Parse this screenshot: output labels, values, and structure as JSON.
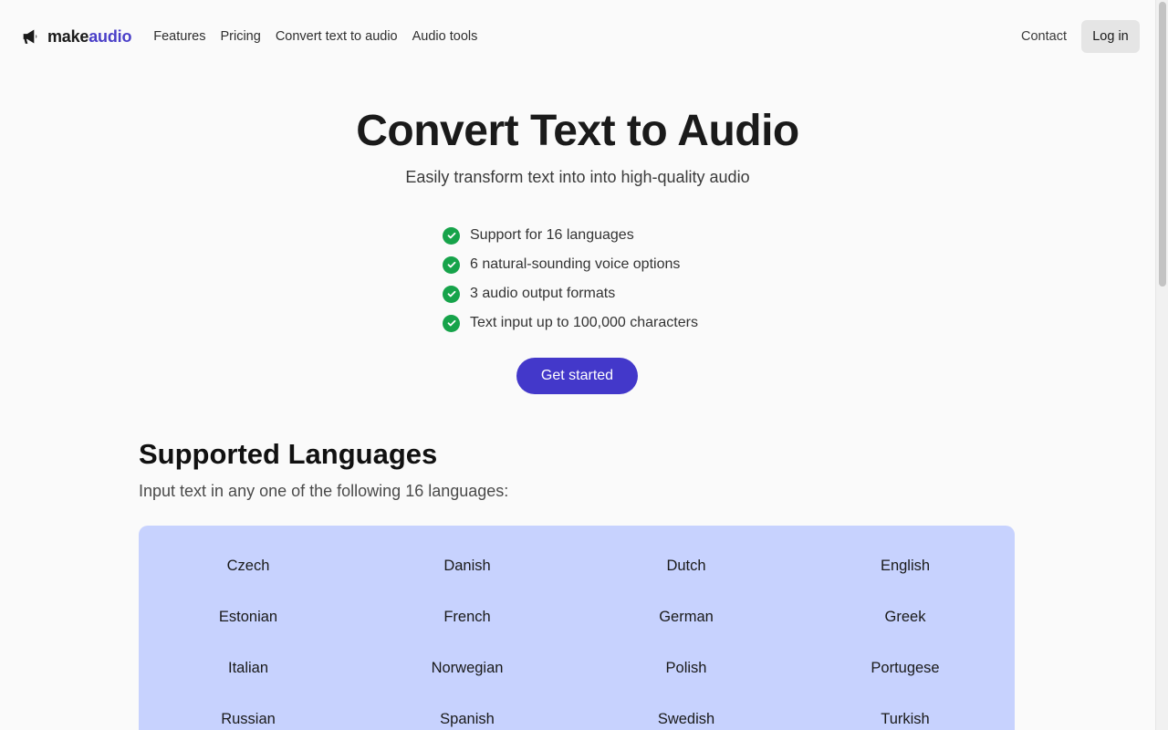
{
  "header": {
    "logo_part1": "make",
    "logo_part2": "audio",
    "logo_icon": "megaphone-icon",
    "nav": [
      "Features",
      "Pricing",
      "Convert text to audio",
      "Audio tools"
    ],
    "contact": "Contact",
    "login": "Log in"
  },
  "hero": {
    "title": "Convert Text to Audio",
    "subtitle": "Easily transform text into into high-quality audio",
    "features": [
      "Support for 16 languages",
      "6 natural-sounding voice options",
      "3 audio output formats",
      "Text input up to 100,000 characters"
    ],
    "cta": "Get started"
  },
  "languages": {
    "title": "Supported Languages",
    "subtitle": "Input text in any one of the following 16 languages:",
    "items": [
      "Czech",
      "Danish",
      "Dutch",
      "English",
      "Estonian",
      "French",
      "German",
      "Greek",
      "Italian",
      "Norwegian",
      "Polish",
      "Portugese",
      "Russian",
      "Spanish",
      "Swedish",
      "Turkish"
    ]
  },
  "colors": {
    "brand": "#4338ca",
    "check": "#16a34a",
    "panel": "#c7d2fe"
  }
}
